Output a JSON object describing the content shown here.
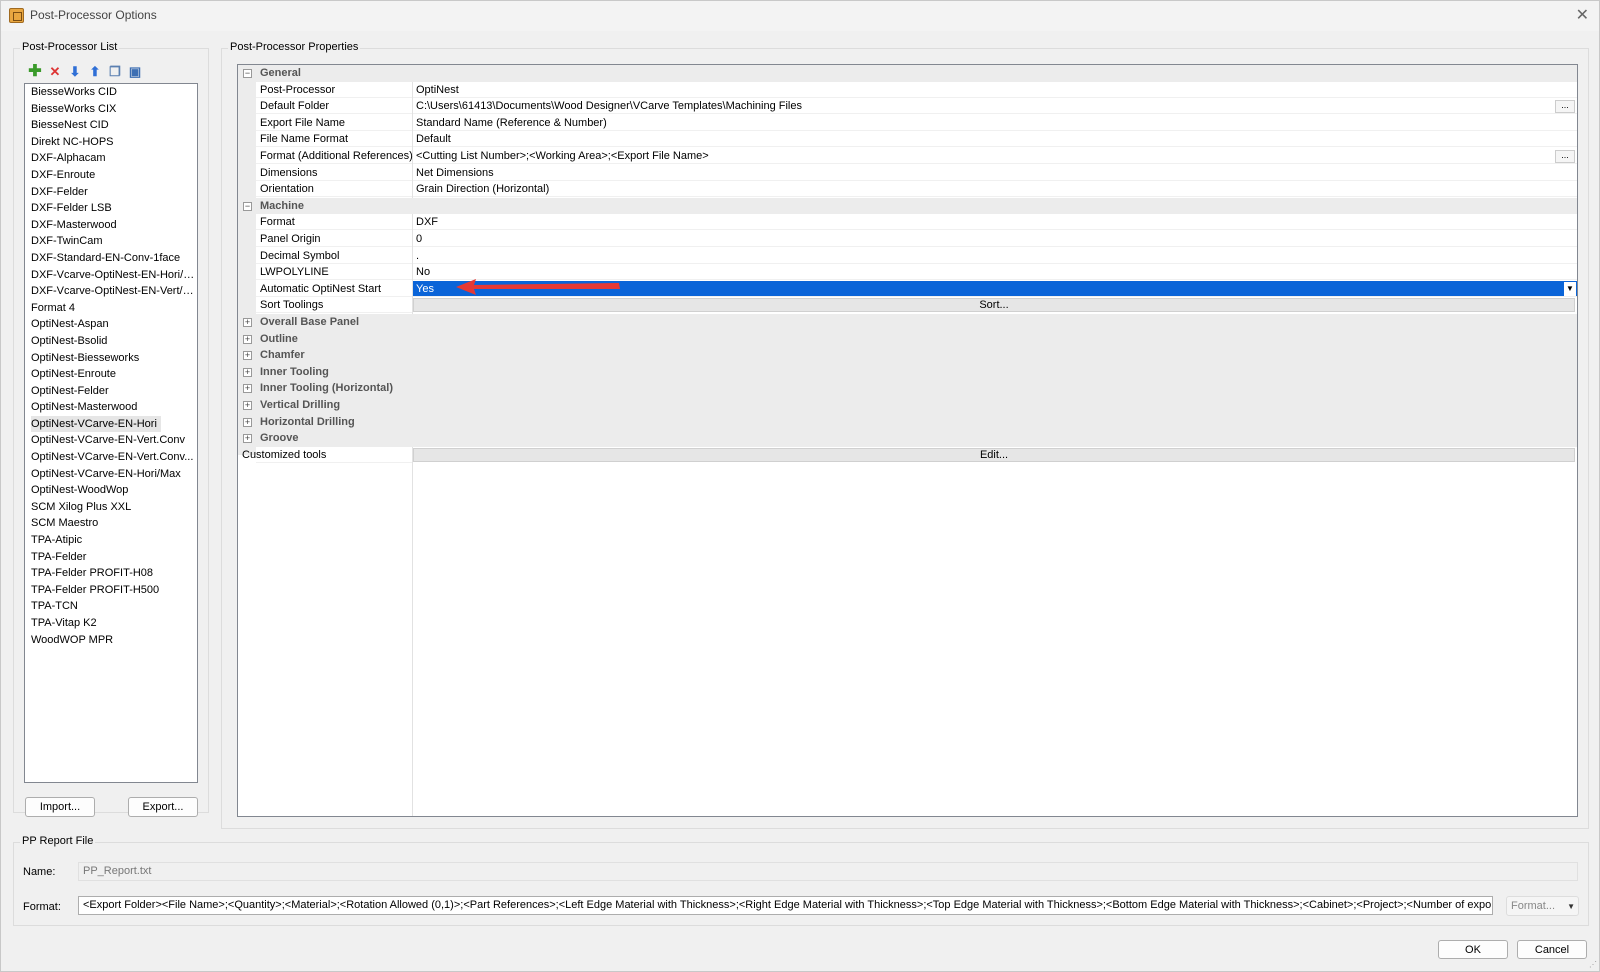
{
  "window": {
    "title": "Post-Processor Options"
  },
  "list_panel": {
    "legend": "Post-Processor List",
    "items": [
      "BiesseWorks CID",
      "BiesseWorks CIX",
      "BiesseNest CID",
      "Direkt NC-HOPS",
      "DXF-Alphacam",
      "DXF-Enroute",
      "DXF-Felder",
      "DXF-Felder LSB",
      "DXF-Masterwood",
      "DXF-TwinCam",
      "DXF-Standard-EN-Conv-1face",
      "DXF-Vcarve-OptiNest-EN-Hori/R...",
      "DXF-Vcarve-OptiNest-EN-Vert/R...",
      "Format 4",
      "OptiNest-Aspan",
      "OptiNest-Bsolid",
      "OptiNest-Biesseworks",
      "OptiNest-Enroute",
      "OptiNest-Felder",
      "OptiNest-Masterwood",
      "OptiNest-VCarve-EN-Hori",
      "OptiNest-VCarve-EN-Vert.Conv",
      "OptiNest-VCarve-EN-Vert.Conv...",
      "OptiNest-VCarve-EN-Hori/Max",
      "OptiNest-WoodWop",
      "SCM Xilog Plus XXL",
      "SCM Maestro",
      "TPA-Atipic",
      "TPA-Felder",
      "TPA-Felder PROFIT-H08",
      "TPA-Felder PROFIT-H500",
      "TPA-TCN",
      "TPA-Vitap K2",
      "WoodWOP MPR"
    ],
    "selected_item": "OptiNest-VCarve-EN-Hori",
    "import_label": "Import...",
    "export_label": "Export..."
  },
  "props_panel": {
    "legend": "Post-Processor Properties",
    "general": {
      "label": "General",
      "rows": [
        {
          "name": "Post-Processor",
          "value": "OptiNest"
        },
        {
          "name": "Default Folder",
          "value": "C:\\Users\\61413\\Documents\\Wood Designer\\VCarve Templates\\Machining Files"
        },
        {
          "name": "Export File Name",
          "value": "Standard Name (Reference & Number)"
        },
        {
          "name": "File Name Format",
          "value": "Default"
        },
        {
          "name": "Format (Additional References)",
          "value": "<Cutting List Number>;<Working Area>;<Export File Name>"
        },
        {
          "name": "Dimensions",
          "value": "Net Dimensions"
        },
        {
          "name": "Orientation",
          "value": "Grain Direction (Horizontal)"
        }
      ],
      "browse_label": "..."
    },
    "machine": {
      "label": "Machine",
      "rows": [
        {
          "name": "Format",
          "value": "DXF"
        },
        {
          "name": "Panel Origin",
          "value": "0"
        },
        {
          "name": "Decimal Symbol",
          "value": "."
        },
        {
          "name": "LWPOLYLINE",
          "value": "No"
        },
        {
          "name": "Automatic OptiNest Start",
          "value": "Yes"
        },
        {
          "name": "Sort Toolings",
          "value": "Sort..."
        }
      ]
    },
    "collapsed_categories": [
      "Overall Base Panel",
      "Outline",
      "Chamfer",
      "Inner Tooling",
      "Inner Tooling (Horizontal)",
      "Vertical Drilling",
      "Horizontal Drilling",
      "Groove"
    ],
    "customized_tools": {
      "name": "Customized tools",
      "value": "Edit..."
    }
  },
  "report": {
    "legend": "PP Report File",
    "name_label": "Name:",
    "name_value": "PP_Report.txt",
    "format_label": "Format:",
    "format_value": "<Export Folder><File Name>;<Quantity>;<Material>;<Rotation Allowed (0,1)>;<Part References>;<Left Edge Material with Thickness>;<Right Edge Material with Thickness>;<Top Edge Material with Thickness>;<Bottom Edge Material with Thickness>;<Cabinet>;<Project>;<Number of exporte",
    "format_button": "Format..."
  },
  "footer": {
    "ok_label": "OK",
    "cancel_label": "Cancel"
  },
  "colors": {
    "selection": "#0a64d8",
    "arrow": "#e53935"
  }
}
